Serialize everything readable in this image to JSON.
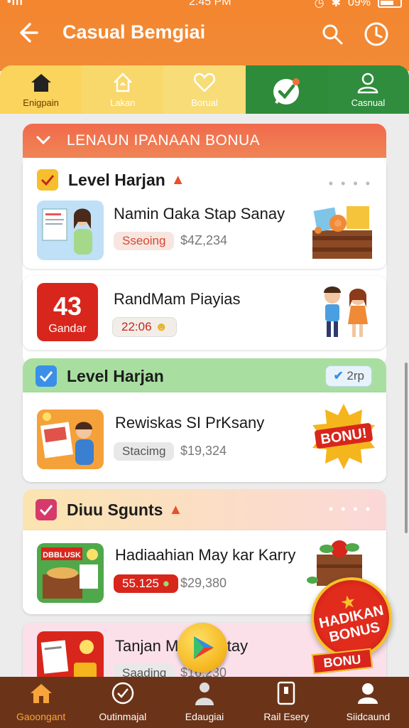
{
  "status": {
    "signal": "•ııl",
    "time": "2:45 PM",
    "battery": "09%"
  },
  "header": {
    "title": "Casual Bemgiai"
  },
  "tabs": [
    {
      "label": "Enigpain",
      "icon": "home-icon"
    },
    {
      "label": "Lakan",
      "icon": "house-outline-icon"
    },
    {
      "label": "Borual",
      "icon": "heart-icon"
    },
    {
      "label": "",
      "icon": "chat-check-icon"
    },
    {
      "label": "Casnual",
      "icon": "user-icon"
    }
  ],
  "section1": {
    "header": "LENAUN IPANAAN BONUA",
    "group_title": "Level Harjan",
    "item1": {
      "title": "Namin Ɑaka Stap Sanay",
      "badge": "Sseoing",
      "price": "$4Z,234"
    },
    "item2": {
      "title": "RandMam Piayias",
      "count": "43",
      "count_label": "Gandar",
      "badge": "22:06"
    }
  },
  "section2": {
    "group_title": "Level Harjan",
    "pill": "2rp",
    "item1": {
      "title": "Rewiskas SI PrKsany",
      "badge": "Stacimg",
      "price": "$19,324"
    },
    "bonus_art_text": "BONU!"
  },
  "section3": {
    "group_title": "Diuu Sgunts",
    "item1": {
      "title": "Hadiaahian May kar Karry",
      "badge": "55.125",
      "price": "$29,380",
      "art_text": "DBBLUSK"
    },
    "item2": {
      "title": "Tanjan M  ieltaystay",
      "badge": "Saading",
      "price": "$16,230"
    }
  },
  "floating_badge": {
    "line1": "HADIKAN",
    "line2": "BONUS",
    "ribbon": "BONU"
  },
  "bottom_nav": [
    {
      "label": "Gaoongant",
      "icon": "home-icon",
      "active": true
    },
    {
      "label": "Outinmajal",
      "icon": "check-circle-icon",
      "active": false
    },
    {
      "label": "Edaugiai",
      "icon": "person-icon",
      "active": false
    },
    {
      "label": "Rail Esery",
      "icon": "phone-icon",
      "active": false
    },
    {
      "label": "Siidcaund",
      "icon": "user-circle-icon",
      "active": false
    }
  ],
  "colors": {
    "orange": "#f4862f",
    "green": "#2e8b3a",
    "red": "#e02b1d",
    "brown": "#6b3418"
  }
}
